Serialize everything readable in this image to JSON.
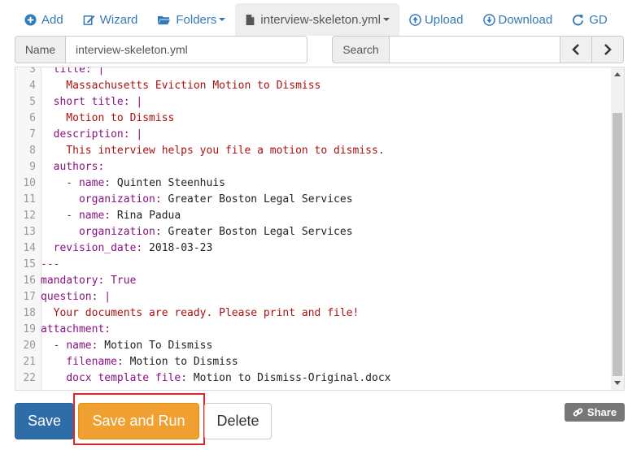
{
  "nav": {
    "add": "Add",
    "wizard": "Wizard",
    "folders": "Folders",
    "file": "interview-skeleton.yml",
    "upload": "Upload",
    "download": "Download",
    "gd": "GD"
  },
  "name_row": {
    "label": "Name",
    "value": "interview-skeleton.yml"
  },
  "search_row": {
    "label": "Search",
    "value": ""
  },
  "editor": {
    "lines": [
      {
        "n": "3",
        "parts": [
          {
            "t": "  ",
            "c": "v"
          },
          {
            "t": "title:",
            "c": "k"
          },
          {
            "t": " |",
            "c": "p"
          }
        ]
      },
      {
        "n": "4",
        "parts": [
          {
            "t": "    Massachusetts Eviction Motion to Dismiss",
            "c": "s"
          }
        ]
      },
      {
        "n": "5",
        "parts": [
          {
            "t": "  ",
            "c": "v"
          },
          {
            "t": "short title:",
            "c": "k"
          },
          {
            "t": " |",
            "c": "p"
          }
        ]
      },
      {
        "n": "6",
        "parts": [
          {
            "t": "    Motion to Dismiss",
            "c": "s"
          }
        ]
      },
      {
        "n": "7",
        "parts": [
          {
            "t": "  ",
            "c": "v"
          },
          {
            "t": "description:",
            "c": "k"
          },
          {
            "t": " |",
            "c": "p"
          }
        ]
      },
      {
        "n": "8",
        "parts": [
          {
            "t": "    This interview helps you file a motion to dismiss.",
            "c": "s"
          }
        ]
      },
      {
        "n": "9",
        "parts": [
          {
            "t": "  ",
            "c": "v"
          },
          {
            "t": "authors:",
            "c": "k"
          }
        ]
      },
      {
        "n": "10",
        "parts": [
          {
            "t": "    - ",
            "c": "k"
          },
          {
            "t": "name:",
            "c": "k"
          },
          {
            "t": " Quinten Steenhuis",
            "c": "v"
          }
        ]
      },
      {
        "n": "11",
        "parts": [
          {
            "t": "      ",
            "c": "v"
          },
          {
            "t": "organization:",
            "c": "k"
          },
          {
            "t": " Greater Boston Legal Services",
            "c": "v"
          }
        ]
      },
      {
        "n": "12",
        "parts": [
          {
            "t": "    - ",
            "c": "k"
          },
          {
            "t": "name:",
            "c": "k"
          },
          {
            "t": " Rina Padua",
            "c": "v"
          }
        ]
      },
      {
        "n": "13",
        "parts": [
          {
            "t": "      ",
            "c": "v"
          },
          {
            "t": "organization:",
            "c": "k"
          },
          {
            "t": " Greater Boston Legal Services",
            "c": "v"
          }
        ]
      },
      {
        "n": "14",
        "parts": [
          {
            "t": "  ",
            "c": "v"
          },
          {
            "t": "revision_date:",
            "c": "k"
          },
          {
            "t": " 2018-03-23",
            "c": "v"
          }
        ]
      },
      {
        "n": "15",
        "parts": [
          {
            "t": "---",
            "c": "k"
          }
        ]
      },
      {
        "n": "16",
        "parts": [
          {
            "t": "mandatory:",
            "c": "k"
          },
          {
            "t": " True",
            "c": "k"
          }
        ]
      },
      {
        "n": "17",
        "parts": [
          {
            "t": "question:",
            "c": "k"
          },
          {
            "t": " |",
            "c": "p"
          }
        ]
      },
      {
        "n": "18",
        "parts": [
          {
            "t": "  Your documents are ready. Please print and file!",
            "c": "s"
          }
        ]
      },
      {
        "n": "19",
        "parts": [
          {
            "t": "attachment:",
            "c": "k"
          }
        ]
      },
      {
        "n": "20",
        "parts": [
          {
            "t": "  - ",
            "c": "k"
          },
          {
            "t": "name:",
            "c": "k"
          },
          {
            "t": " Motion To Dismiss",
            "c": "v"
          }
        ]
      },
      {
        "n": "21",
        "parts": [
          {
            "t": "    ",
            "c": "v"
          },
          {
            "t": "filename:",
            "c": "k"
          },
          {
            "t": " Motion to Dismiss",
            "c": "v"
          }
        ]
      },
      {
        "n": "22",
        "parts": [
          {
            "t": "    ",
            "c": "v"
          },
          {
            "t": "docx template file:",
            "c": "k"
          },
          {
            "t": " Motion to Dismiss-Original.docx",
            "c": "v"
          }
        ]
      }
    ]
  },
  "buttons": {
    "save": "Save",
    "save_and_run": "Save and Run",
    "delete": "Delete",
    "share": "Share"
  },
  "colors": {
    "link": "#337ab7",
    "primary": "#2f6da8",
    "warning": "#f0a030",
    "highlight": "#d9292c"
  }
}
